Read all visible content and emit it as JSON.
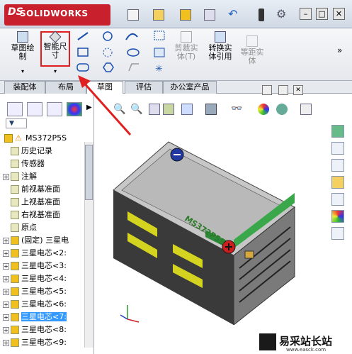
{
  "app": {
    "brand": "SOLIDWORKS",
    "brand_prefix": "DS"
  },
  "titlebar": {
    "icons": [
      "new-icon",
      "open-icon",
      "save-icon",
      "print-icon",
      "undo-icon",
      "rebuild-icon",
      "options-icon"
    ],
    "window": {
      "minimize": "–",
      "restore": "□",
      "close": "✕"
    }
  },
  "ribbon": {
    "sketch_label": "草图绘\n制",
    "smart_dim_label": "智能尺\n寸",
    "trim_label": "剪裁实\n体(T)",
    "convert_label": "转换实\n体引用",
    "offset_label": "等距实\n体"
  },
  "tabs": [
    "装配体",
    "布局",
    "草图",
    "评估",
    "办公室产品"
  ],
  "active_tab": "草图",
  "tree": {
    "filter": "▼",
    "root": "MS372P5S",
    "items": [
      {
        "label": "历史记录",
        "exp": false
      },
      {
        "label": "传感器",
        "exp": false
      },
      {
        "label": "注解",
        "exp": true
      },
      {
        "label": "前视基准面",
        "exp": false
      },
      {
        "label": "上视基准面",
        "exp": false
      },
      {
        "label": "右视基准面",
        "exp": false
      },
      {
        "label": "原点",
        "exp": false
      },
      {
        "label": "(固定) 三星电",
        "exp": true
      },
      {
        "label": "三星电芯<2:",
        "exp": true
      },
      {
        "label": "三星电芯<3:",
        "exp": true
      },
      {
        "label": "三星电芯<4:",
        "exp": true
      },
      {
        "label": "三星电芯<5:",
        "exp": true
      },
      {
        "label": "三星电芯<6:",
        "exp": true
      },
      {
        "label": "三星电芯<7:",
        "exp": true
      },
      {
        "label": "三星电芯<8:",
        "exp": true
      },
      {
        "label": "三星电芯<9:",
        "exp": true
      }
    ],
    "selected_index": 13
  },
  "model": {
    "label": "MS372P5S"
  },
  "watermark": {
    "title": "易采站长站",
    "url": "www.easck.com"
  },
  "colors": {
    "accent": "#c8202c",
    "highlight": "#e02020",
    "select": "#3399ff"
  }
}
